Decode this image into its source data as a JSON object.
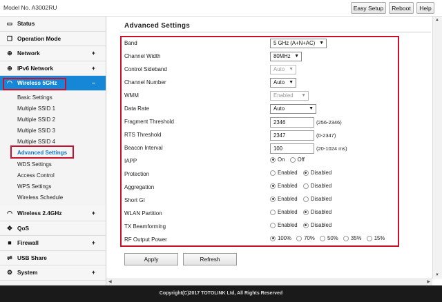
{
  "header": {
    "model": "Model No. A3002RU",
    "buttons": {
      "easy_setup": "Easy Setup",
      "reboot": "Reboot",
      "help": "Help"
    }
  },
  "sidebar": {
    "status": "Status",
    "operation_mode": "Operation Mode",
    "network": "Network",
    "ipv6_network": "IPv6 Network",
    "wireless_5g": "Wireless 5GHz",
    "wireless_5g_subs": [
      "Basic Settings",
      "Multiple SSID 1",
      "Multiple SSID 2",
      "Multiple SSID 3",
      "Multiple SSID 4",
      "Advanced Settings",
      "WDS Settings",
      "Access Control",
      "WPS Settings",
      "Wireless Schedule"
    ],
    "wireless_24g": "Wireless 2.4GHz",
    "qos": "QoS",
    "firewall": "Firewall",
    "usb_share": "USB Share",
    "system": "System",
    "plus": "+",
    "minus": "–"
  },
  "main": {
    "title": "Advanced Settings",
    "labels": {
      "band": "Band",
      "channel_width": "Channel Width",
      "control_sideband": "Control Sideband",
      "channel_number": "Channel Number",
      "wmm": "WMM",
      "data_rate": "Data Rate",
      "fragment": "Fragment Threshold",
      "rts": "RTS Threshold",
      "beacon": "Beacon Interval",
      "iapp": "IAPP",
      "protection": "Protection",
      "aggregation": "Aggregation",
      "short_gi": "Short GI",
      "wlan_partition": "WLAN Partition",
      "tx_beamforming": "TX Beamforming",
      "rf_power": "RF Output Power"
    },
    "values": {
      "band": "5 GHz (A+N+AC)",
      "channel_width": "80MHz",
      "control_sideband": "Auto",
      "channel_number": "Auto",
      "wmm": "Enabled",
      "data_rate": "Auto",
      "fragment": "2346",
      "rts": "2347",
      "beacon": "100"
    },
    "hints": {
      "fragment": "(256-2346)",
      "rts": "(0-2347)",
      "beacon": "(20-1024 ms)"
    },
    "options": {
      "on": "On",
      "off": "Off",
      "enabled": "Enabled",
      "disabled": "Disabled",
      "p100": "100%",
      "p70": "70%",
      "p50": "50%",
      "p35": "35%",
      "p15": "15%"
    },
    "apply": "Apply",
    "refresh": "Refresh"
  },
  "footer": "Copyright(C)2017 TOTOLINK Ltd, All Rights Reserved",
  "colors": {
    "accent": "#1587d6",
    "highlight": "#c8102e",
    "footer": "#1a1a1a"
  },
  "icons": {
    "status": "monitor-icon",
    "operation_mode": "window-icon",
    "network": "globe-icon",
    "ipv6": "globe-icon",
    "wireless_5g": "wifi-icon",
    "wireless_24g": "wifi-icon",
    "qos": "qos-icon",
    "firewall": "briefcase-icon",
    "usb_share": "usb-icon",
    "system": "gear-icon"
  }
}
